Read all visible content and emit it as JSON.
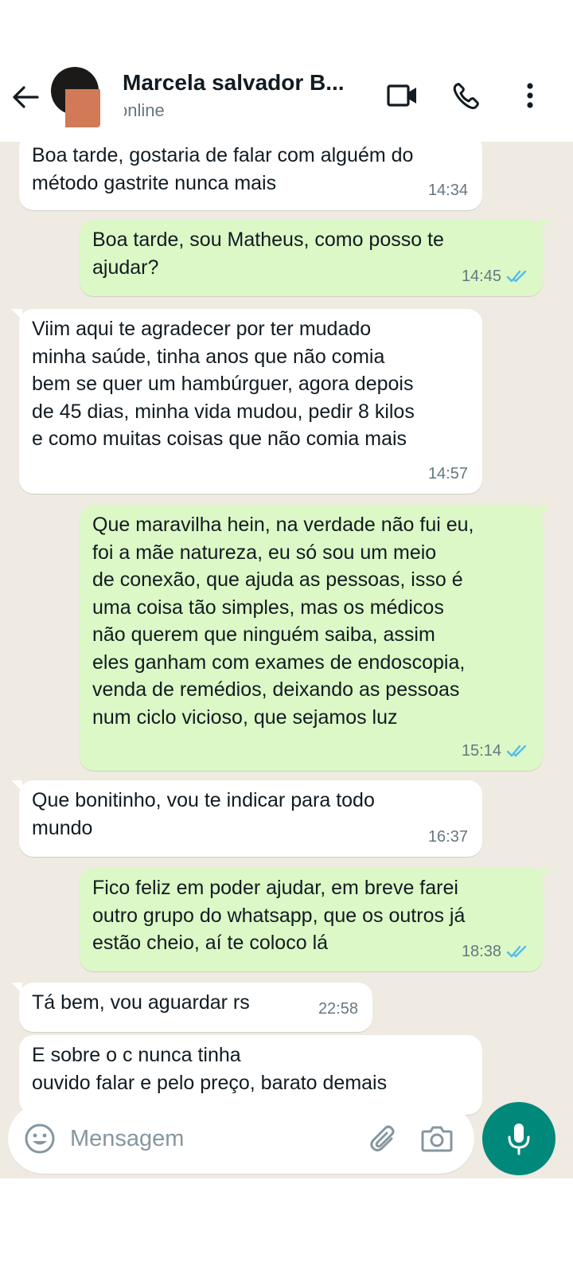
{
  "header": {
    "contact_name": "Marcela salvador B...",
    "status": "online",
    "icons": [
      "back-arrow-icon",
      "video-call-icon",
      "phone-icon",
      "more-options-icon"
    ]
  },
  "messages": [
    {
      "direction": "incoming",
      "text": "Boa tarde, gostaria de falar com alguém do\nmétodo gastrite nunca mais",
      "time": "14:34"
    },
    {
      "direction": "outgoing",
      "text": "Boa tarde, sou Matheus, como posso te\najudar?",
      "time": "14:45",
      "status": "read"
    },
    {
      "direction": "incoming",
      "text": "Viim aqui te agradecer por ter mudado\nminha saúde, tinha anos que não comia\nbem se quer um hambúrguer, agora depois\nde 45 dias, minha vida mudou, pedir 8 kilos\ne como muitas coisas que não comia mais",
      "time": "14:57"
    },
    {
      "direction": "outgoing",
      "text": "Que maravilha hein, na verdade não fui eu,\nfoi a mãe natureza, eu só sou um meio\nde conexão, que ajuda as pessoas, isso é\numa coisa tão simples, mas os médicos\nnão querem que ninguém saiba, assim\neles ganham com exames de endoscopia,\nvenda de remédios, deixando as pessoas\nnum ciclo vicioso, que sejamos luz",
      "time": "15:14",
      "status": "read"
    },
    {
      "direction": "incoming",
      "text": "Que bonitinho, vou te indicar para todo\nmundo",
      "time": "16:37"
    },
    {
      "direction": "outgoing",
      "text": "Fico feliz em poder ajudar, em breve farei\noutro grupo do whatsapp, que os outros já\nestão cheio, aí te coloco lá",
      "time": "18:38",
      "status": "read"
    },
    {
      "direction": "incoming",
      "text": "Tá bem, vou aguardar rs",
      "time": "22:58"
    },
    {
      "direction": "incoming",
      "text": "E sobre o c                                        nunca tinha\nouvido falar e pelo preço, barato demais",
      "time": ""
    }
  ],
  "composer": {
    "placeholder": "Mensagem",
    "icons": [
      "emoji-icon",
      "attach-icon",
      "camera-icon",
      "mic-icon"
    ]
  },
  "colors": {
    "chat_bg": "#efeae2",
    "incoming_bubble": "#ffffff",
    "outgoing_bubble": "#dcf8c6",
    "read_ticks": "#53bdeb",
    "mic_button": "#00897b"
  }
}
